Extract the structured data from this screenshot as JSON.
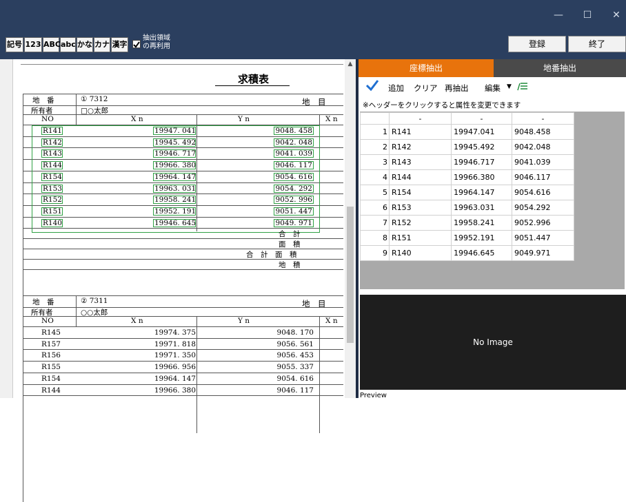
{
  "window": {
    "minimize": "—",
    "maximize": "☐",
    "close": "✕"
  },
  "toolbar": {
    "buttons": [
      "記号",
      "123",
      "ABC",
      "abc",
      "かな",
      "カナ",
      "漢字"
    ],
    "checkbox_checked": true,
    "checkbox_label_1": "抽出領域",
    "checkbox_label_2": "の再利用",
    "register": "登録",
    "exit": "終了"
  },
  "document": {
    "title": "求積表",
    "table1": {
      "chiban_label": "地　番",
      "chiban": "① 7312",
      "chimoku_label": "地　目",
      "owner_label": "所有者",
      "owner": "□○太郎",
      "no_label": "NO",
      "xn_label": "X n",
      "yn_label": "Y n",
      "xn2_label": "X n",
      "rows": [
        {
          "no": "R141",
          "x": "19947. 041",
          "y": "9048. 458"
        },
        {
          "no": "R142",
          "x": "19945. 492",
          "y": "9042. 048"
        },
        {
          "no": "R143",
          "x": "19946. 717",
          "y": "9041. 039"
        },
        {
          "no": "R144",
          "x": "19966. 380",
          "y": "9046. 117"
        },
        {
          "no": "R154",
          "x": "19964. 147",
          "y": "9054. 616"
        },
        {
          "no": "R153",
          "x": "19963. 031",
          "y": "9054. 292"
        },
        {
          "no": "R152",
          "x": "19958. 241",
          "y": "9052. 996"
        },
        {
          "no": "R151",
          "x": "19952. 191",
          "y": "9051. 447"
        },
        {
          "no": "R140",
          "x": "19946. 645",
          "y": "9049. 971"
        }
      ],
      "sum": "合　計",
      "area": "面　積",
      "total_area": "合　計　面　積",
      "land_area": "地　積"
    },
    "table2": {
      "chiban_label": "地　番",
      "chiban": "② 7311",
      "chimoku_label": "地　目",
      "owner_label": "所有者",
      "owner": "○○太郎",
      "no_label": "NO",
      "xn_label": "X n",
      "yn_label": "Y n",
      "xn2_label": "X n",
      "rows": [
        {
          "no": "R145",
          "x": "19974. 375",
          "y": "9048. 170"
        },
        {
          "no": "R157",
          "x": "19971. 818",
          "y": "9056. 561"
        },
        {
          "no": "R156",
          "x": "19971. 350",
          "y": "9056. 453"
        },
        {
          "no": "R155",
          "x": "19966. 956",
          "y": "9055. 337"
        },
        {
          "no": "R154",
          "x": "19964. 147",
          "y": "9054. 616"
        },
        {
          "no": "R144",
          "x": "19966. 380",
          "y": "9046. 117"
        }
      ]
    }
  },
  "panel": {
    "tab_active": "座標抽出",
    "tab_inactive": "地番抽出",
    "tools": {
      "add": "追加",
      "clear": "クリア",
      "reextract": "再抽出",
      "edit": "編集"
    },
    "hint": "※ヘッダーをクリックすると属性を変更できます",
    "grid_headers": [
      "-",
      "-",
      "-"
    ],
    "grid_rows": [
      {
        "n": "1",
        "c1": "R141",
        "c2": "19947.041",
        "c3": "9048.458"
      },
      {
        "n": "2",
        "c1": "R142",
        "c2": "19945.492",
        "c3": "9042.048"
      },
      {
        "n": "3",
        "c1": "R143",
        "c2": "19946.717",
        "c3": "9041.039"
      },
      {
        "n": "4",
        "c1": "R144",
        "c2": "19966.380",
        "c3": "9046.117"
      },
      {
        "n": "5",
        "c1": "R154",
        "c2": "19964.147",
        "c3": "9054.616"
      },
      {
        "n": "6",
        "c1": "R153",
        "c2": "19963.031",
        "c3": "9054.292"
      },
      {
        "n": "7",
        "c1": "R152",
        "c2": "19958.241",
        "c3": "9052.996"
      },
      {
        "n": "8",
        "c1": "R151",
        "c2": "19952.191",
        "c3": "9051.447"
      },
      {
        "n": "9",
        "c1": "R140",
        "c2": "19946.645",
        "c3": "9049.971"
      }
    ],
    "no_image": "No Image",
    "preview": "Preview"
  },
  "colors": {
    "titlebar": "#2b3f5f",
    "accent_tab": "#e8730c",
    "inactive_tab": "#4a4a4a",
    "highlight": "#2ea043"
  }
}
